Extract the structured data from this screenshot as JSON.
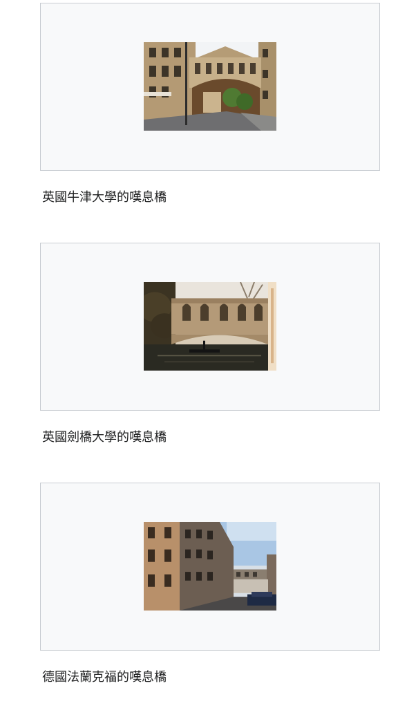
{
  "gallery": {
    "items": [
      {
        "image": "oxford-bridge-of-sighs-photo",
        "caption": "英國牛津大學的嘆息橋"
      },
      {
        "image": "cambridge-bridge-of-sighs-photo",
        "caption": "英國劍橋大學的嘆息橋"
      },
      {
        "image": "frankfurt-bridge-of-sighs-photo",
        "caption": "德國法蘭克福的嘆息橋"
      }
    ]
  }
}
